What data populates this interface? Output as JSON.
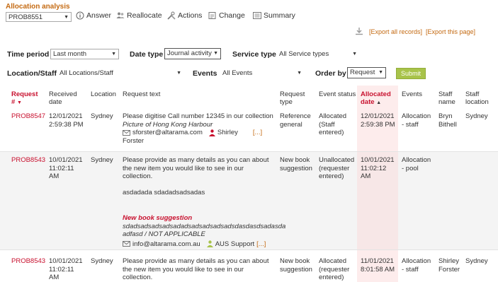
{
  "header": {
    "title": "Allocation analysis",
    "request_select": "PROB8551",
    "toolbar": {
      "answer": "Answer",
      "reallocate": "Reallocate",
      "actions": "Actions",
      "change": "Change",
      "summary": "Summary"
    },
    "export_all": "[Export all records]",
    "export_page": "[Export this page]"
  },
  "filters": {
    "time_period_label": "Time period",
    "time_period_value": "Last month",
    "date_type_label": "Date type",
    "date_type_value": "Journal activity",
    "service_type_label": "Service type",
    "service_type_value": "All Service types",
    "location_label": "Location/Staff",
    "location_value": "All Locations/Staff",
    "events_label": "Events",
    "events_value": "All Events",
    "order_by_label": "Order by",
    "order_by_value": "Request",
    "submit": "Submit"
  },
  "columns": {
    "request": "Request",
    "request_hash": "#",
    "received1": "Received",
    "received2": "date",
    "location": "Location",
    "request_text": "Request text",
    "request_type1": "Request",
    "request_type2": "type",
    "event_status": "Event status",
    "allocated1": "Allocated",
    "allocated2": "date",
    "events": "Events",
    "staff_name1": "Staff",
    "staff_name2": "name",
    "staff_loc1": "Staff",
    "staff_loc2": "location"
  },
  "rows": [
    {
      "id": "PROB8547",
      "received1": "12/01/2021",
      "received2": "2:59:38 PM",
      "location": "Sydney",
      "text": "Please digitise Call number 12345 in our collection",
      "subtitle": "Picture of Hong Kong Harbour",
      "email": "sforster@altarama.com",
      "person1": "Shirley",
      "person2": "Forster",
      "more": "[...]",
      "type1": "Reference",
      "type2": "general",
      "status1": "Allocated",
      "status2": "(Staff",
      "status3": "entered)",
      "alloc1": "12/01/2021",
      "alloc2": "2:59:38 PM",
      "events1": "Allocation",
      "events2": "- staff",
      "staff1": "Bryn",
      "staff2": "Bithell",
      "staff_loc": "Sydney"
    },
    {
      "id": "PROB8543",
      "received1": "10/01/2021",
      "received2": "11:02:11",
      "received3": "AM",
      "location": "Sydney",
      "text1": "Please provide as many details as you can about",
      "text2": "the new item you would like to see in our",
      "text3": "collection.",
      "text4": "asdadada sdadadsadsadas",
      "nbs_title": "New book suggestion",
      "nbs1": "sdadsadsadsadsadadsadsadsadsadsdasdasdsadasda",
      "nbs2": "adfasd / NOT APPLICABLE",
      "email": "info@altarama.com.au",
      "person": "AUS Support",
      "more": "[...]",
      "type1": "New book",
      "type2": "suggestion",
      "status1": "Unallocated",
      "status2": "(requester",
      "status3": "entered)",
      "alloc1": "10/01/2021",
      "alloc2": "11:02:12",
      "alloc3": "AM",
      "events1": "Allocation",
      "events2": "- pool"
    },
    {
      "id": "PROB8543",
      "received1": "10/01/2021",
      "received2": "11:02:11",
      "received3": "AM",
      "location": "Sydney",
      "text1": "Please provide as many details as you can about",
      "text2": "the new item you would like to see in our",
      "text3": "collection.",
      "type1": "New book",
      "type2": "suggestion",
      "status1": "Allocated",
      "status2": "(requester",
      "status3": "entered)",
      "alloc1": "11/01/2021",
      "alloc2": "8:01:58 AM",
      "events1": "Allocation",
      "events2": "- staff",
      "staff1": "Shirley",
      "staff2": "Forster",
      "staff_loc": "Sydney"
    }
  ]
}
